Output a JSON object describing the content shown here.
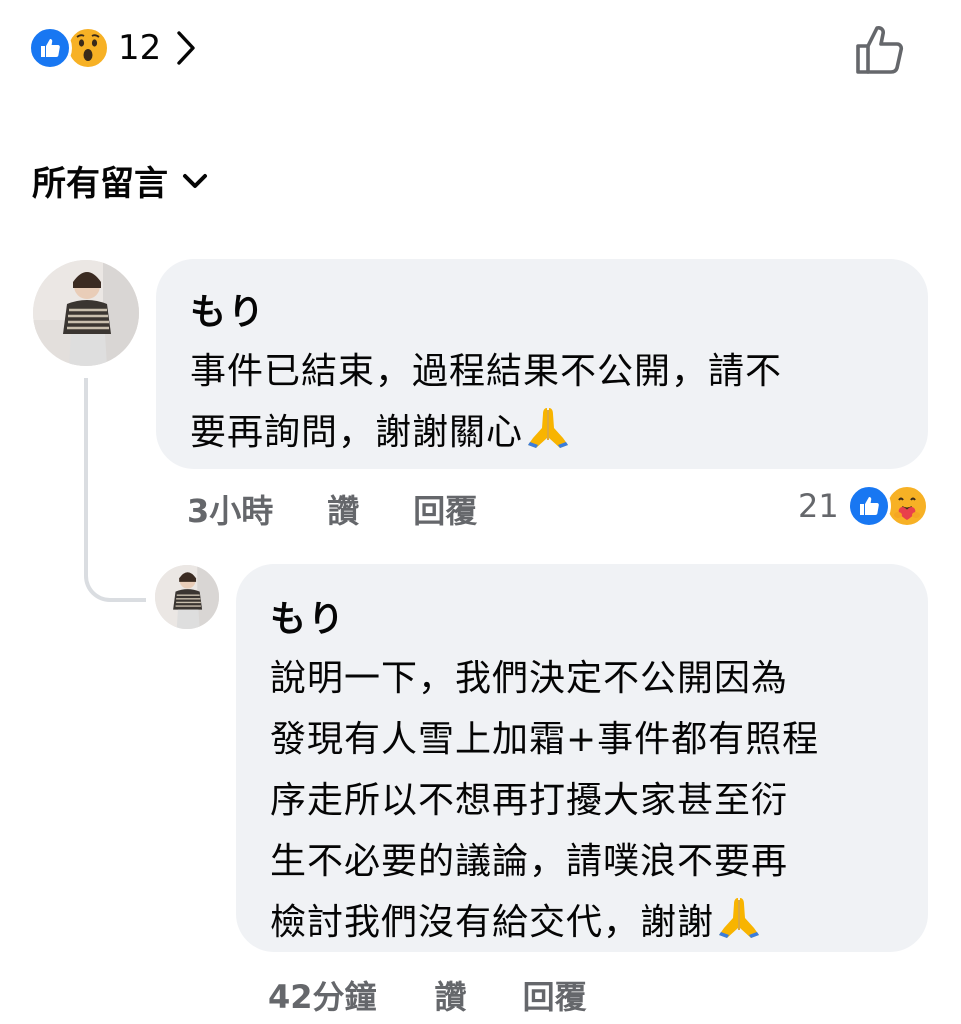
{
  "reactions": {
    "count": "12",
    "types": [
      "like-icon",
      "wow-icon"
    ]
  },
  "filter": {
    "label": "所有留言"
  },
  "comments": [
    {
      "author": "もり",
      "text": "事件已結束，過程結果不公開，請不\n要再詢問，謝謝關心",
      "time": "3小時",
      "like_label": "讚",
      "reply_label": "回覆",
      "reaction_count": "21",
      "reaction_types": [
        "like-icon",
        "care-icon"
      ]
    },
    {
      "author": "もり",
      "text": "說明一下，我們決定不公開因為\n發現有人雪上加霜+事件都有照程\n序走所以不想再打擾大家甚至衍\n生不必要的議論，請噗浪不要再\n檢討我們沒有給交代，謝謝",
      "time": "42分鐘",
      "like_label": "讚",
      "reply_label": "回覆"
    }
  ],
  "colors": {
    "facebook_blue": "#1877f2",
    "bubble_bg": "#f0f2f5",
    "meta_gray": "#65676b",
    "thread_line": "#dadde1"
  }
}
